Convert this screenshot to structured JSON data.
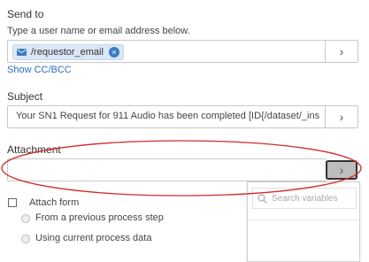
{
  "send_to": {
    "label": "Send to",
    "hint": "Type a user name or email address below.",
    "chip": "/requestor_email",
    "chip_remove": "×",
    "show_cc_bcc": "Show CC/BCC",
    "button_glyph": "›"
  },
  "subject": {
    "label": "Subject",
    "value": "Your SN1 Request for 911 Audio has been completed [ID{/dataset/_ins",
    "button_glyph": "›"
  },
  "attachment": {
    "label": "Attachment",
    "value": "",
    "button_glyph": "›"
  },
  "attach_form": {
    "label": "Attach form",
    "checked": false,
    "options": [
      {
        "label": "From a previous process step"
      },
      {
        "label": "Using current process data"
      }
    ]
  },
  "variables_dropdown": {
    "search_placeholder": "Search variables"
  },
  "colors": {
    "chip_bg": "#dbe7f4",
    "link": "#2a6ebb",
    "annotation": "#d22a2a"
  },
  "icons": {
    "chip": "envelope-icon",
    "chip_remove": "close-icon",
    "field_button": "chevron-right-icon",
    "dropdown_search": "search-icon"
  }
}
